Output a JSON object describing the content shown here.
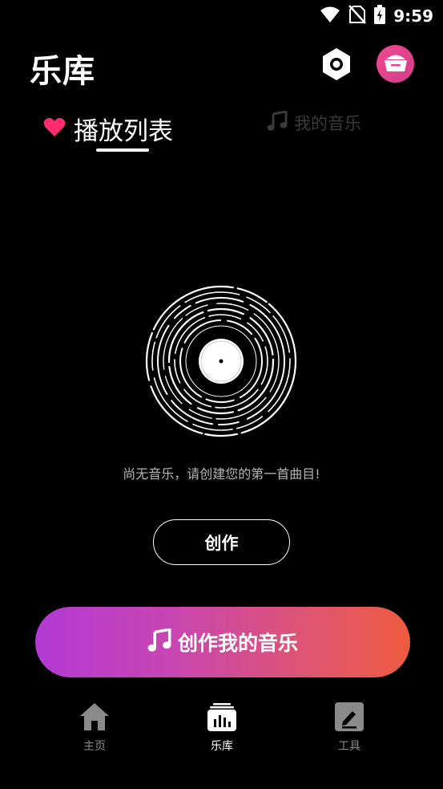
{
  "status_bar": {
    "time": "9:59",
    "icons": [
      "wifi-icon",
      "no-sim-icon",
      "battery-charging-icon"
    ]
  },
  "header": {
    "title": "乐库",
    "settings_icon": "settings-hexagon-icon",
    "shop_icon": "crown-basket-icon"
  },
  "tabs": [
    {
      "label": "播放列表",
      "icon": "heart-icon",
      "active": true
    },
    {
      "label": "我的音乐",
      "icon": "music-note-icon",
      "active": false
    }
  ],
  "empty_state": {
    "illustration": "vinyl-record-icon",
    "message": "尚无音乐，请创建您的第一首曲目!",
    "create_label": "创作"
  },
  "cta": {
    "icon": "music-note-icon",
    "label": "创作我的音乐"
  },
  "bottom_nav": [
    {
      "label": "主页",
      "icon": "home-icon",
      "active": false
    },
    {
      "label": "乐库",
      "icon": "library-icon",
      "active": true
    },
    {
      "label": "工具",
      "icon": "edit-icon",
      "active": false
    }
  ],
  "colors": {
    "background": "#000000",
    "accent_pink": "#ff2d6f",
    "cta_gradient_start": "#b23ad3",
    "cta_gradient_end": "#ef5a3e",
    "inactive": "#8a8a8a"
  }
}
